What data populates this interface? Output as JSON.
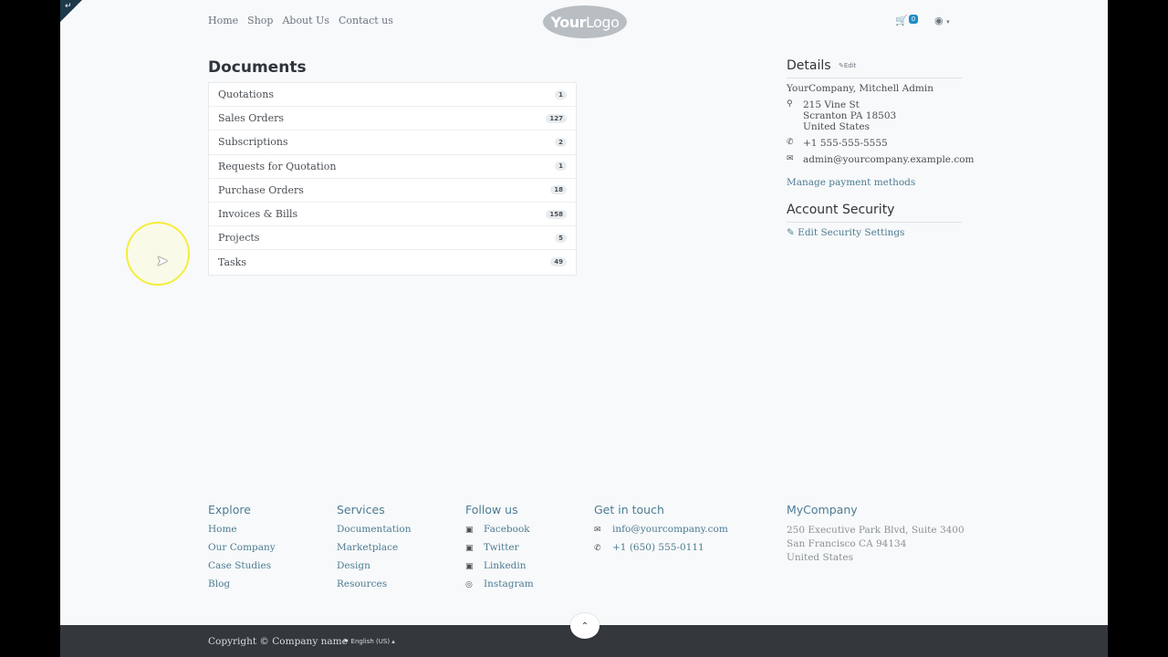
{
  "nav": {
    "links": [
      "Home",
      "Shop",
      "About Us",
      "Contact us"
    ],
    "logo_bold": "Your",
    "logo_rest": "Logo",
    "cart_count": "0"
  },
  "documents": {
    "title": "Documents",
    "items": [
      {
        "label": "Quotations",
        "count": "1"
      },
      {
        "label": "Sales Orders",
        "count": "127"
      },
      {
        "label": "Subscriptions",
        "count": "2"
      },
      {
        "label": "Requests for Quotation",
        "count": "1"
      },
      {
        "label": "Purchase Orders",
        "count": "18"
      },
      {
        "label": "Invoices & Bills",
        "count": "158"
      },
      {
        "label": "Projects",
        "count": "5"
      },
      {
        "label": "Tasks",
        "count": "49"
      }
    ]
  },
  "details": {
    "title": "Details",
    "edit_label": "Edit",
    "name": "YourCompany, Mitchell Admin",
    "address_line1": "215 Vine St",
    "address_line2": "Scranton PA 18503",
    "address_line3": "United States",
    "phone": "+1 555-555-5555",
    "email": "admin@yourcompany.example.com",
    "payment_link": "Manage payment methods"
  },
  "security": {
    "title": "Account Security",
    "edit_link": "Edit Security Settings"
  },
  "footer": {
    "explore": {
      "title": "Explore",
      "links": [
        "Home",
        "Our Company",
        "Case Studies",
        "Blog"
      ]
    },
    "services": {
      "title": "Services",
      "links": [
        "Documentation",
        "Marketplace",
        "Design",
        "Resources"
      ]
    },
    "follow": {
      "title": "Follow us",
      "links": [
        "Facebook",
        "Twitter",
        "Linkedin",
        "Instagram"
      ]
    },
    "contact": {
      "title": "Get in touch",
      "email": "info@yourcompany.com",
      "phone": "+1 (650) 555-0111"
    },
    "company": {
      "title": "MyCompany",
      "line1": "250 Executive Park Blvd, Suite 3400",
      "line2": "San Francisco CA 94134",
      "line3": "United States"
    }
  },
  "bottom": {
    "copyright": "Copyright © Company name",
    "language": "English (US)"
  },
  "colors": {
    "accent": "#4d7c93",
    "badge_blue": "#1f8cc4",
    "footer_bar": "#34383c",
    "cursor_highlight": "#f4ed3d"
  }
}
